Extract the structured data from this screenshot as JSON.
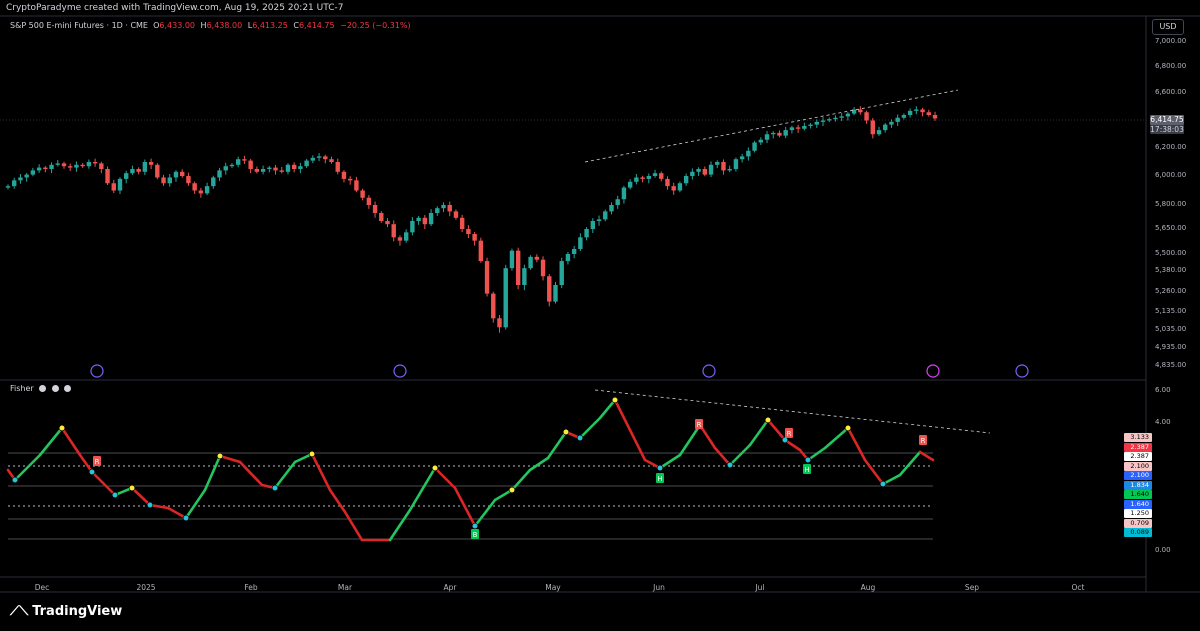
{
  "credit": "CryptoParadyme created with TradingView.com, Aug 19, 2025 20:21 UTC-7",
  "symbol": {
    "name": "S&P 500 E-mini Futures · 1D · CME",
    "o_label": "O",
    "o": "6,433.00",
    "h_label": "H",
    "h": "6,438.00",
    "l_label": "L",
    "l": "6,413.25",
    "c_label": "C",
    "c": "6,414.75",
    "change": "−20.25 (−0.31%)"
  },
  "currency_button": "USD",
  "price_axis": [
    "7,000.00",
    "6,800.00",
    "6,600.00",
    "6,200.00",
    "6,000.00",
    "5,800.00",
    "5,650.00",
    "5,500.00",
    "5,380.00",
    "5,260.00",
    "5,135.00",
    "5,035.00",
    "4,935.00",
    "4,835.00"
  ],
  "current_price": "6,414.75",
  "countdown": "17:38:03",
  "fisher": {
    "label": "Fisher",
    "axis": [
      "6.00",
      "4.00",
      "0.00"
    ],
    "badges": [
      {
        "text": "3.133",
        "bg": "#f7c5c5",
        "fg": "#000000"
      },
      {
        "text": "2.387",
        "bg": "#f23645",
        "fg": "#ffffff"
      },
      {
        "text": "2.387",
        "bg": "#ffffff",
        "fg": "#000000"
      },
      {
        "text": "2.100",
        "bg": "#f7c5c5",
        "fg": "#000000"
      },
      {
        "text": "2.100",
        "bg": "#2962ff",
        "fg": "#ffffff"
      },
      {
        "text": "1.834",
        "bg": "#1e88e5",
        "fg": "#ffffff"
      },
      {
        "text": "1.640",
        "bg": "#00c853",
        "fg": "#000000"
      },
      {
        "text": "1.640",
        "bg": "#2962ff",
        "fg": "#ffffff"
      },
      {
        "text": "1.250",
        "bg": "#ffffff",
        "fg": "#000000"
      },
      {
        "text": "0.709",
        "bg": "#f7c5c5",
        "fg": "#000000"
      },
      {
        "text": "0.089",
        "bg": "#00bcd4",
        "fg": "#000000"
      }
    ],
    "markers": [
      "B",
      "R",
      "R",
      "R",
      "R",
      "H",
      "H",
      "R"
    ]
  },
  "time_axis": [
    "Dec",
    "2025",
    "Feb",
    "Mar",
    "Apr",
    "May",
    "Jun",
    "Jul",
    "Aug",
    "Sep",
    "Oct"
  ],
  "footer": "TradingView",
  "colors": {
    "up": "#26a69a",
    "down": "#ef5350",
    "fisher_up": "#22c55e",
    "fisher_down": "#dc2626"
  },
  "chart_data": {
    "type": "candlestick",
    "x_start": "Nov 2024",
    "x_end": "Oct 2025",
    "ylim": [
      4835,
      7000
    ],
    "closes": [
      5930,
      5970,
      5990,
      6010,
      6040,
      6060,
      6050,
      6080,
      6090,
      6070,
      6060,
      6080,
      6070,
      6100,
      6090,
      6050,
      5950,
      5900,
      5980,
      6020,
      6050,
      6030,
      6100,
      6080,
      5990,
      5950,
      5990,
      6030,
      6000,
      5950,
      5900,
      5880,
      5930,
      5990,
      6040,
      6070,
      6080,
      6120,
      6110,
      6050,
      6030,
      6050,
      6060,
      6040,
      6030,
      6080,
      6050,
      6070,
      6110,
      6130,
      6140,
      6120,
      6100,
      6030,
      5980,
      5970,
      5900,
      5850,
      5800,
      5750,
      5700,
      5680,
      5600,
      5580,
      5630,
      5700,
      5720,
      5680,
      5750,
      5780,
      5800,
      5760,
      5720,
      5650,
      5620,
      5580,
      5450,
      5250,
      5100,
      5050,
      5400,
      5520,
      5300,
      5400,
      5480,
      5460,
      5350,
      5200,
      5300,
      5450,
      5500,
      5530,
      5600,
      5650,
      5700,
      5710,
      5760,
      5800,
      5840,
      5920,
      5960,
      5990,
      5980,
      6000,
      6020,
      5980,
      5930,
      5900,
      5950,
      6000,
      6030,
      6050,
      6010,
      6080,
      6100,
      6040,
      6050,
      6120,
      6140,
      6180,
      6240,
      6260,
      6300,
      6310,
      6290,
      6330,
      6350,
      6340,
      6360,
      6370,
      6390,
      6400,
      6410,
      6420,
      6430,
      6450,
      6480,
      6460,
      6400,
      6300,
      6330,
      6370,
      6390,
      6420,
      6440,
      6470,
      6480,
      6460,
      6440,
      6415
    ]
  }
}
